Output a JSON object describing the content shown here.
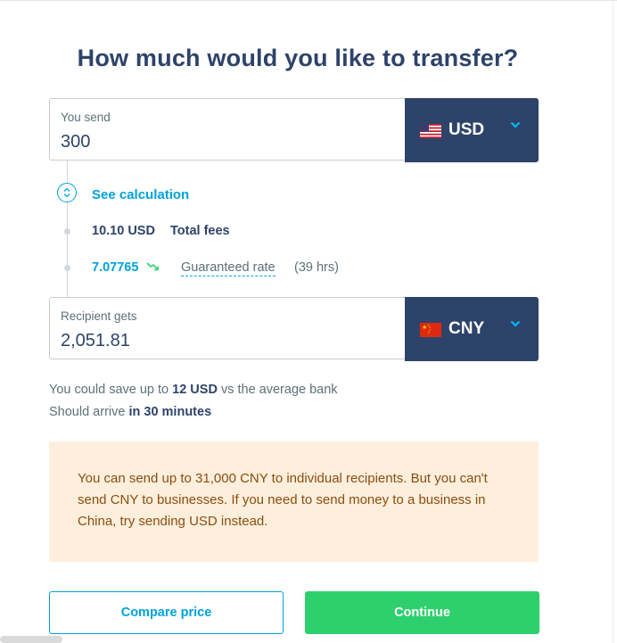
{
  "page": {
    "title": "How much would you like to transfer?"
  },
  "send": {
    "label": "You send",
    "amount": "300",
    "currency": {
      "code": "USD",
      "flag_icon": "us-flag-icon"
    }
  },
  "calculation": {
    "toggle_label": "See calculation",
    "fee": {
      "amount": "10.10 USD",
      "label": "Total fees"
    },
    "rate": {
      "value": "7.07765",
      "trend_icon": "trend-down-icon",
      "label": "Guaranteed rate",
      "duration": "(39 hrs)"
    }
  },
  "receive": {
    "label": "Recipient gets",
    "amount": "2,051.81",
    "currency": {
      "code": "CNY",
      "flag_icon": "china-flag-icon"
    }
  },
  "savings": {
    "prefix": "You could save up to",
    "amount": "12 USD",
    "suffix": "vs the average bank",
    "arrival_prefix": "Should arrive",
    "arrival_time": "in 30 minutes"
  },
  "notice": {
    "text": "You can send up to 31,000 CNY to individual recipients. But you can't send CNY to businesses. If you need to send money to a business in China, try sending USD instead."
  },
  "actions": {
    "compare_label": "Compare price",
    "continue_label": "Continue"
  },
  "colors": {
    "navy": "#2e4369",
    "accent_blue": "#00a2dd",
    "green": "#2ed06e",
    "notice_bg": "#feefdc",
    "notice_text": "#8a4d12"
  }
}
